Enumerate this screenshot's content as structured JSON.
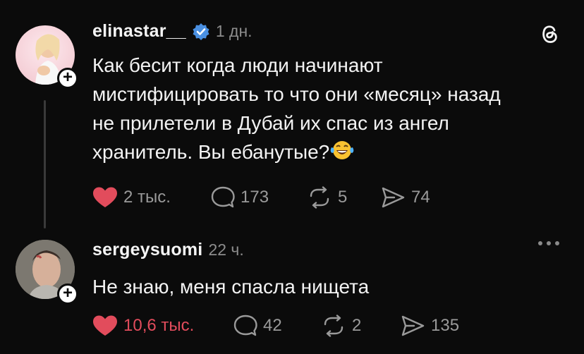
{
  "posts": [
    {
      "username": "elinastar__",
      "verified": true,
      "time": "1 дн.",
      "text_lines": [
        "Как бесит когда люди начинают",
        "мистифицировать то что они «месяц» назад",
        "не прилетели в Дубай их спас из ангел",
        "хранитель. Вы ебанутые?"
      ],
      "emoji_icon": "laughing-crying-emoji-icon",
      "likes": "2 тыс.",
      "liked": false,
      "comments": "173",
      "reposts": "5",
      "shares": "74",
      "corner_icon": "threads-logo-icon"
    },
    {
      "username": "sergeysuomi",
      "verified": false,
      "time": "22 ч.",
      "text_lines": [
        "Не знаю, меня спасла нищета"
      ],
      "likes": "10,6 тыс.",
      "liked": true,
      "comments": "42",
      "reposts": "2",
      "shares": "135",
      "corner_icon": "more-options-icon"
    }
  ],
  "colors": {
    "background": "#0b0b0b",
    "like_red": "#e24c5c",
    "secondary_text": "#8c8c8c",
    "verified_blue": "#4a90e2"
  }
}
